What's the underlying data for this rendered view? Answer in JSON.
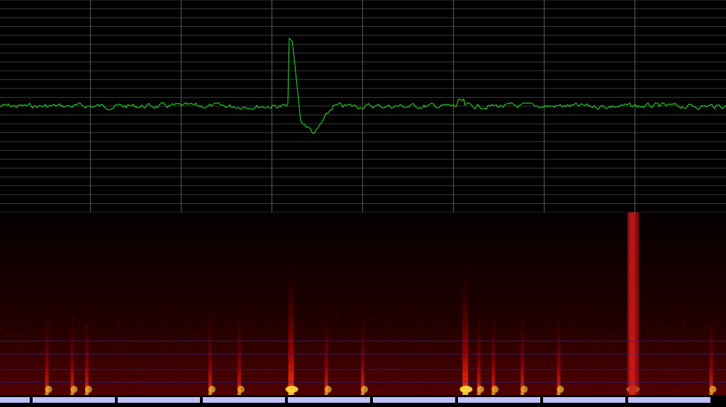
{
  "colors": {
    "background": "#000000",
    "grid": "#5a5a5a",
    "grid_fine": "#3a3a3a",
    "waveform": "#22ee22",
    "spectrogram_low": "#1a0000",
    "spectrogram_mid": "#b00000",
    "spectrogram_high": "#ff2000",
    "spectrogram_peak": "#ffe040",
    "spectrogram_grid": "#2a2a90",
    "timeline_block": "#c0c0ff"
  },
  "waveform": {
    "baseline_level": 0.5,
    "spike_peak_level": 0.82,
    "spike_trough_level": 0.37
  },
  "spectrogram": {
    "onsets": [
      0.065,
      0.1,
      0.12,
      0.29,
      0.33,
      0.4,
      0.45,
      0.5,
      0.64,
      0.66,
      0.68,
      0.72,
      0.77,
      0.87,
      0.98
    ],
    "strong_onsets": [
      0.4,
      0.64,
      0.87
    ]
  },
  "timeline": {
    "segment_count": 9
  }
}
